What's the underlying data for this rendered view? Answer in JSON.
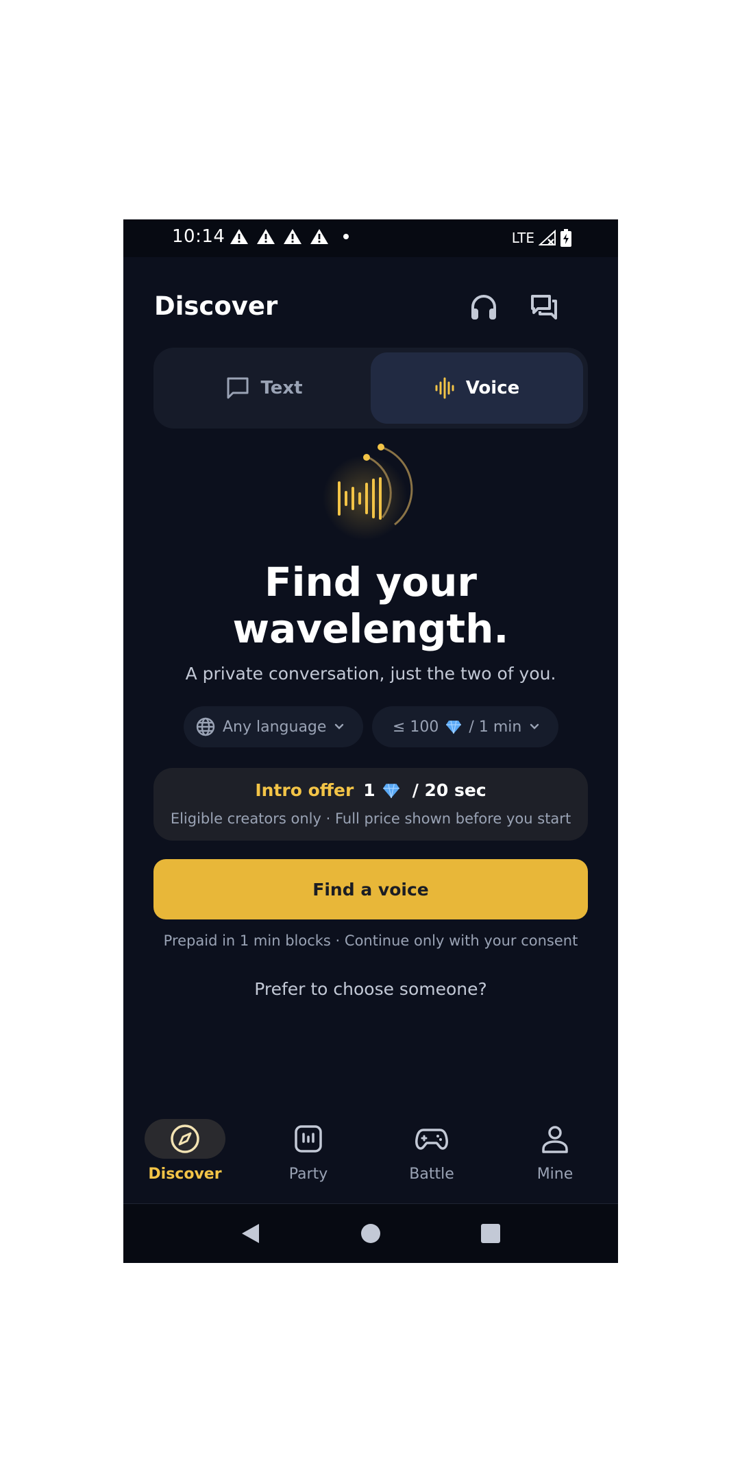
{
  "status_bar": {
    "time": "10:14",
    "network": "LTE"
  },
  "header": {
    "title": "Discover",
    "icons": [
      "headset-icon",
      "chat-bubbles-icon"
    ]
  },
  "mode_toggle": {
    "tabs": [
      {
        "label": "Text",
        "icon": "chat-bubble-icon",
        "selected": false
      },
      {
        "label": "Voice",
        "icon": "waveform-icon",
        "selected": true
      }
    ]
  },
  "hero": {
    "title_line1": "Find your",
    "title_line2": "wavelength.",
    "subtitle": "A private conversation, just the two of you."
  },
  "filters": {
    "language": "Any language",
    "price_prefix": "≤ 100",
    "price_suffix": "/ 1 min"
  },
  "offer": {
    "label": "Intro offer",
    "amount": "1",
    "duration": "/ 20 sec",
    "note": "Eligible creators only · Full price shown before you start"
  },
  "cta": {
    "label": "Find a voice",
    "note": "Prepaid in 1 min blocks · Continue only with your consent"
  },
  "choose_link": "Prefer to choose someone?",
  "bottom_nav": {
    "items": [
      {
        "label": "Discover",
        "icon": "compass-icon",
        "active": true
      },
      {
        "label": "Party",
        "icon": "party-icon",
        "active": false
      },
      {
        "label": "Battle",
        "icon": "gamepad-icon",
        "active": false
      },
      {
        "label": "Mine",
        "icon": "person-icon",
        "active": false
      }
    ]
  },
  "colors": {
    "background": "#0c101d",
    "accent": "#e8b739",
    "accent_text": "#f3c447",
    "diamond": "#5aa9f5"
  }
}
